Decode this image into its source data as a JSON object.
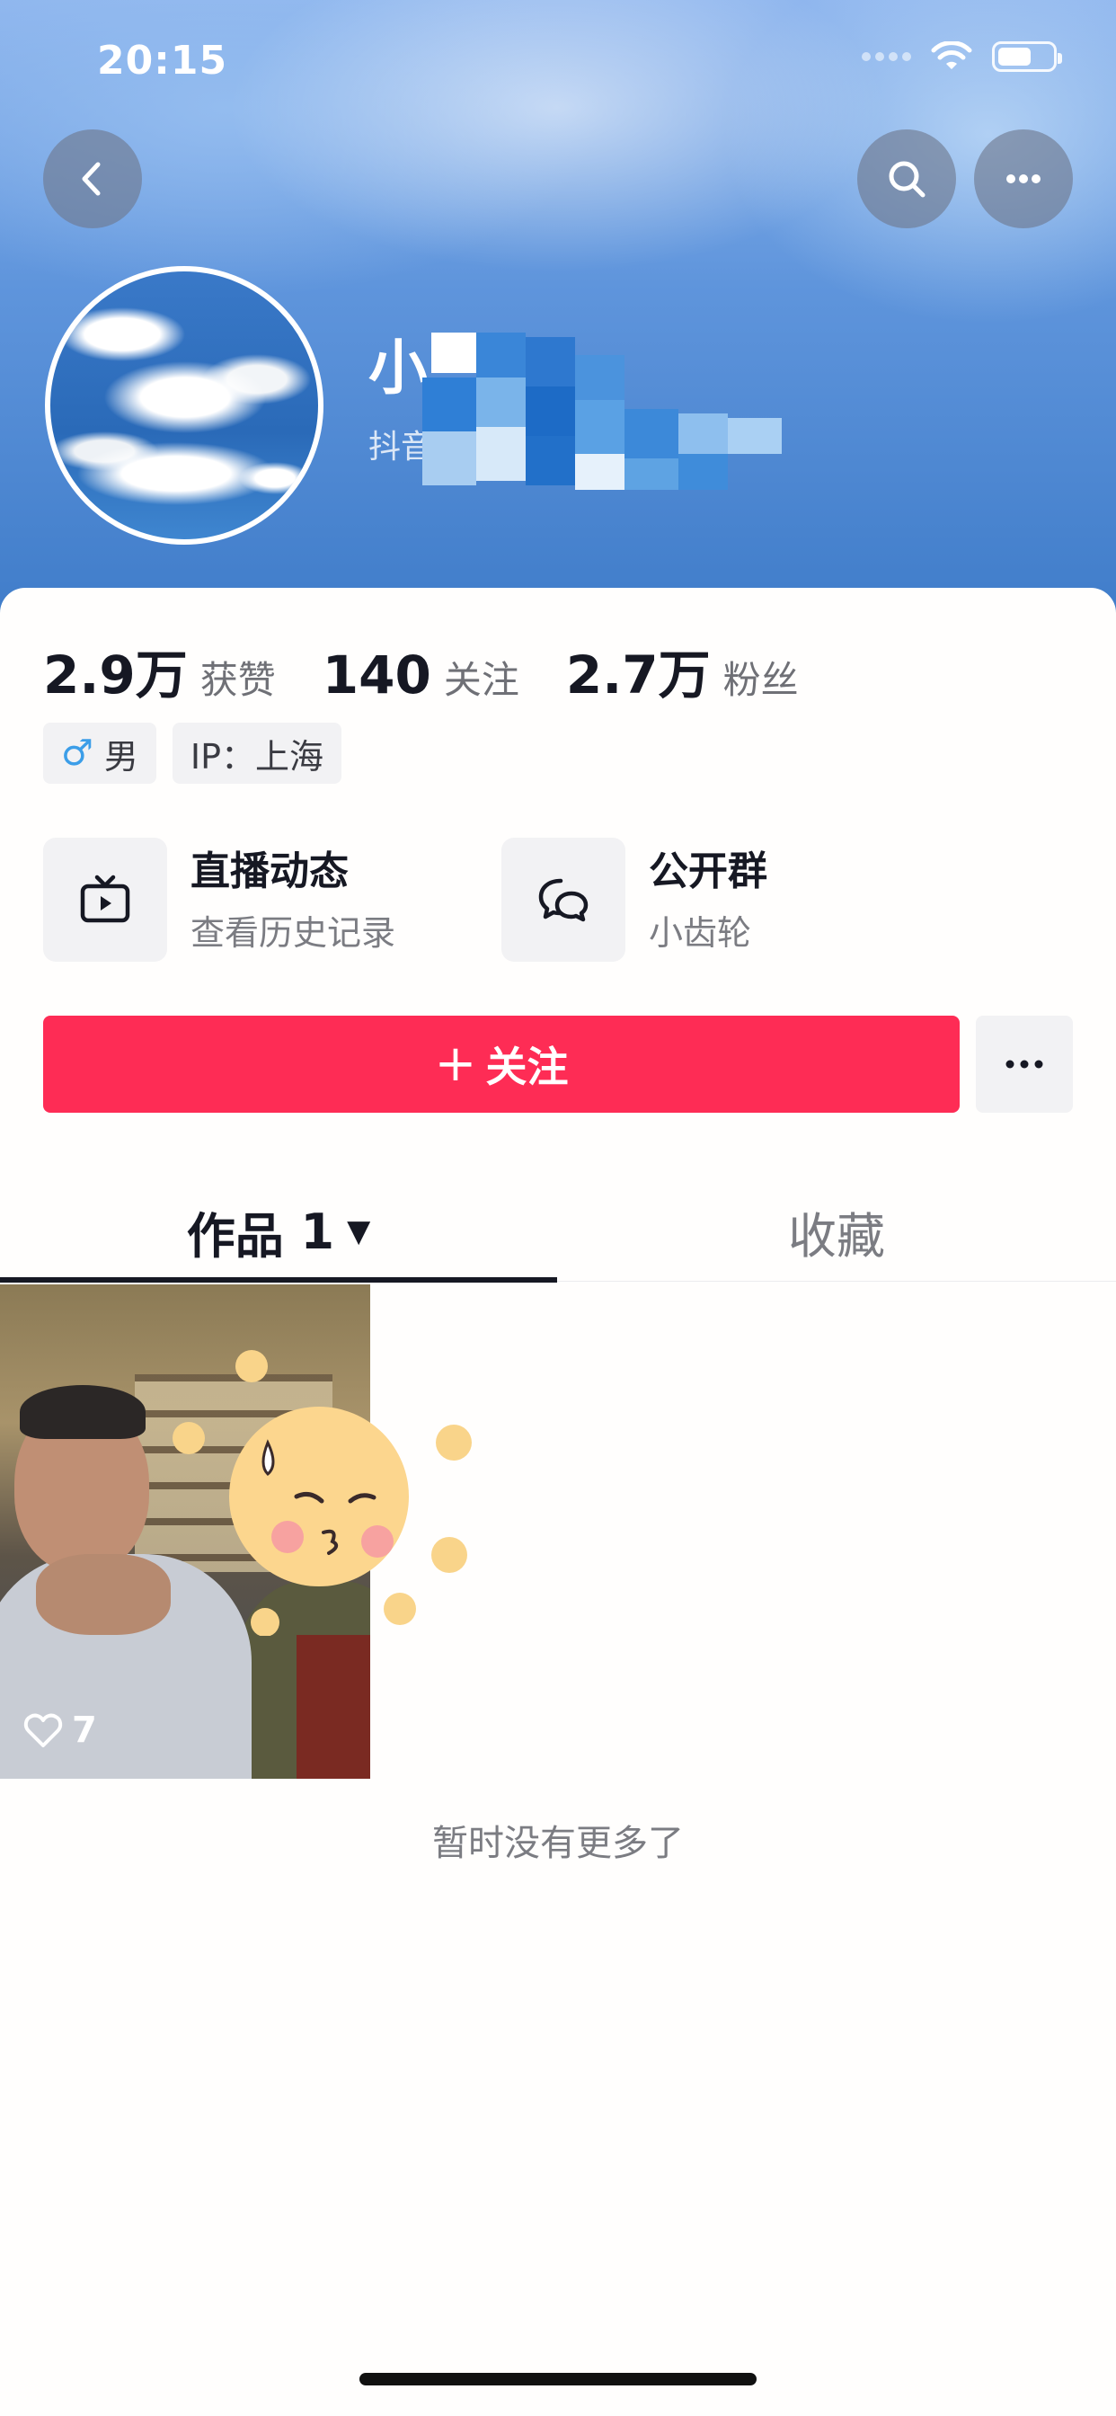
{
  "status_bar": {
    "time": "20:15"
  },
  "header": {
    "back_icon": "chevron-left-icon",
    "search_icon": "search-icon",
    "more_icon": "ellipsis-icon",
    "nickname": "小",
    "douyin_id": "抖音号：",
    "nickname_mosaic": true
  },
  "stats": [
    {
      "num": "2.9万",
      "label": "获赞"
    },
    {
      "num": "140",
      "label": "关注"
    },
    {
      "num": "2.7万",
      "label": "粉丝"
    }
  ],
  "tags": {
    "gender_symbol": "♂",
    "gender": "男",
    "ip": "IP：上海"
  },
  "entries": {
    "live": {
      "title": "直播动态",
      "subtitle": "查看历史记录",
      "icon": "tv-icon"
    },
    "group": {
      "title": "公开群",
      "subtitle": "小齿轮",
      "icon": "chat-bubbles-icon"
    }
  },
  "follow": {
    "plus": "+",
    "label": "关注",
    "more_icon": "ellipsis-icon"
  },
  "tabs": {
    "works": {
      "label": "作品",
      "count": "1",
      "caret": "▼"
    },
    "favorites": {
      "label": "收藏"
    },
    "active": "works"
  },
  "videos": [
    {
      "likes": "7",
      "like_icon": "heart-outline-icon"
    }
  ],
  "footer_text": "暂时没有更多了",
  "colors": {
    "accent": "#fe2c55",
    "male": "#3c9ee8",
    "text_primary": "#161823",
    "text_secondary": "#7b7c82"
  }
}
